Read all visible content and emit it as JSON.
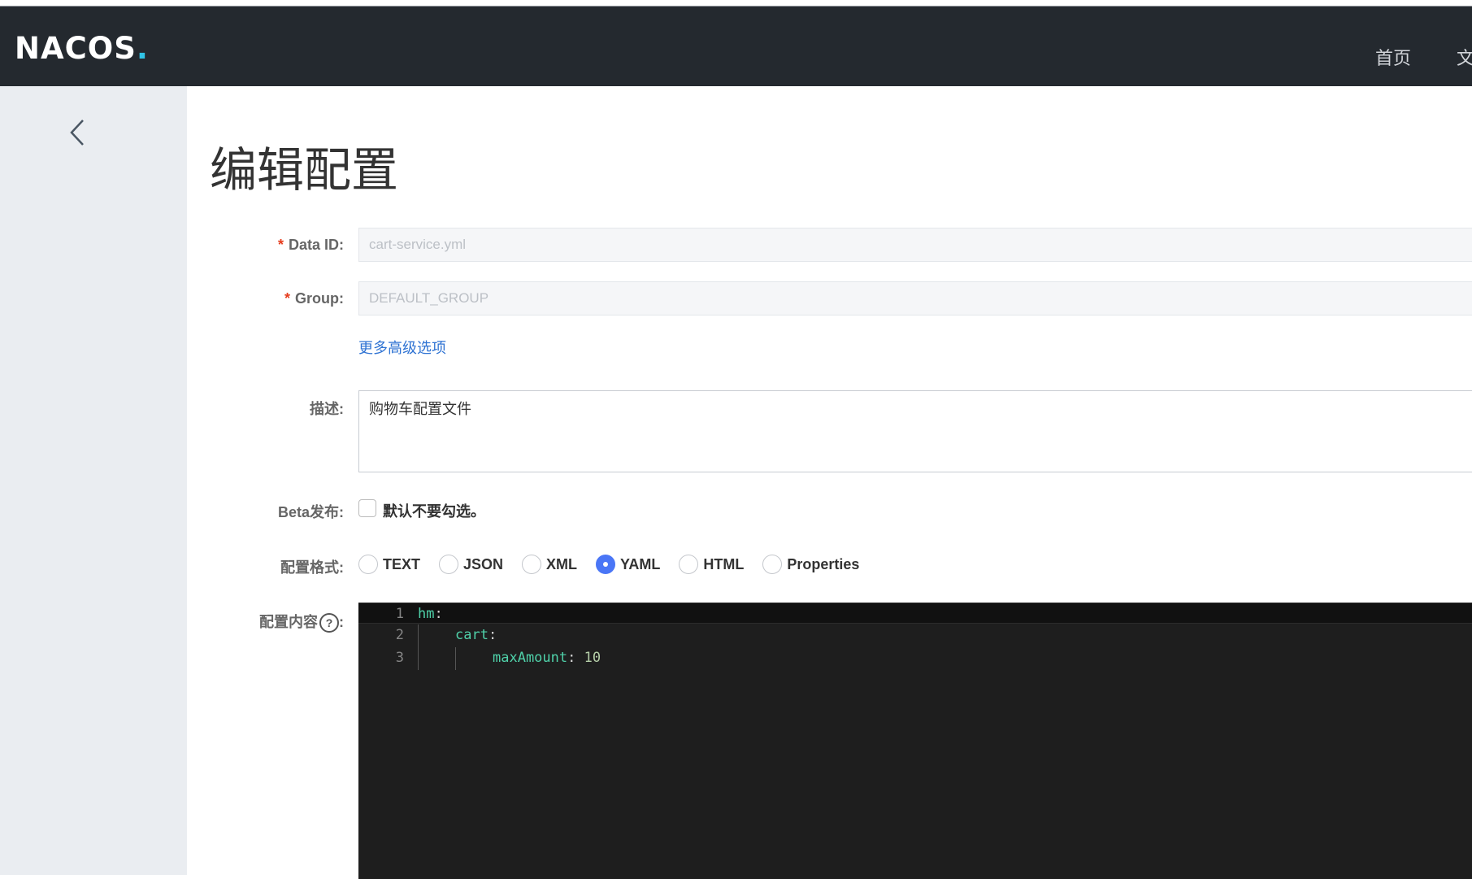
{
  "brand": {
    "name": "NACOS",
    "dot": "."
  },
  "nav": {
    "home": "首页",
    "docs": "文"
  },
  "page": {
    "title": "编辑配置"
  },
  "form": {
    "data_id": {
      "required_mark": "*",
      "label": "Data ID:",
      "value": "cart-service.yml"
    },
    "group": {
      "required_mark": "*",
      "label": "Group:",
      "value": "DEFAULT_GROUP"
    },
    "advanced_link": "更多高级选项",
    "description": {
      "label": "描述:",
      "value": "购物车配置文件"
    },
    "beta": {
      "label": "Beta发布:",
      "checkbox_label": "默认不要勾选。",
      "checked": false
    },
    "format": {
      "label": "配置格式:",
      "options": [
        "TEXT",
        "JSON",
        "XML",
        "YAML",
        "HTML",
        "Properties"
      ],
      "selected": "YAML"
    },
    "content": {
      "label": "配置内容",
      "help": "?",
      "colon": ":",
      "line_numbers": [
        "1",
        "2",
        "3"
      ],
      "lines": [
        {
          "key": "hm",
          "sep": ":",
          "value": ""
        },
        {
          "key": "cart",
          "sep": ":",
          "value": ""
        },
        {
          "key": "maxAmount",
          "sep": ": ",
          "value": "10"
        }
      ]
    }
  },
  "colors": {
    "topbar": "#24292f",
    "sidebar": "#eaedf1",
    "accent": "#4a76f6",
    "link": "#2f73d3",
    "required": "#e63d1e",
    "editor_bg": "#1e1e1e",
    "yaml_key": "#4fd1a9",
    "yaml_number": "#b5cea8"
  }
}
